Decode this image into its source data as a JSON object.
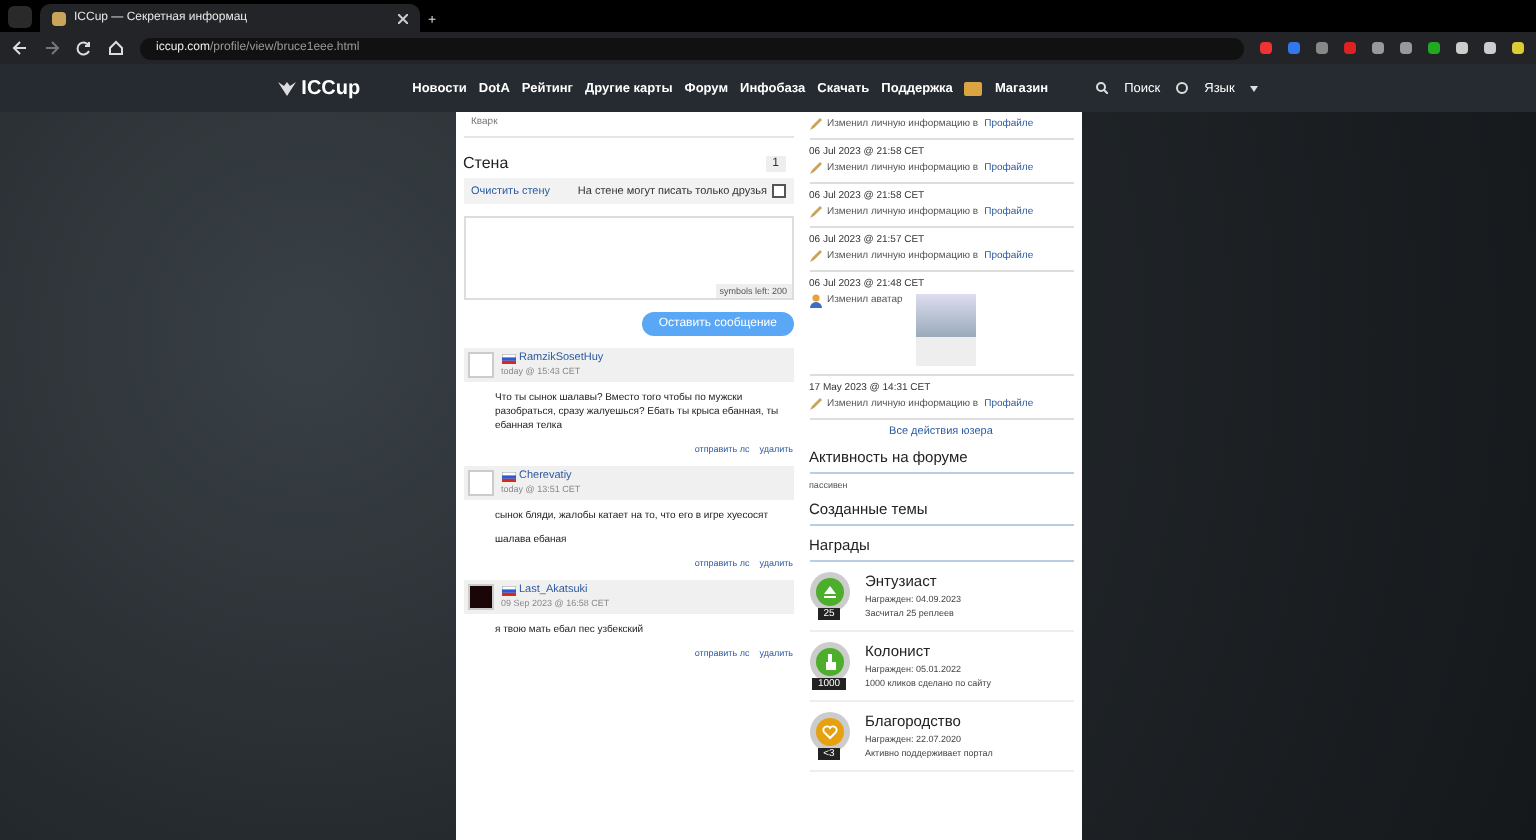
{
  "browser": {
    "tab_title": "ICCup — Секретная информац",
    "new_tab": "+",
    "url_host": "iccup.com",
    "url_path": "/profile/view/bruce1eee.html"
  },
  "site": {
    "logo": "ICCup",
    "nav": [
      "Новости",
      "DotA",
      "Рейтинг",
      "Другие карты",
      "Форум",
      "Инфобаза",
      "Скачать",
      "Поддержка"
    ],
    "shop": "Магазин",
    "search": "Поиск",
    "language": "Язык"
  },
  "profile_note": "Кварк",
  "wall": {
    "title": "Стена",
    "page": "1",
    "clear_link": "Очистить стену",
    "friends_only_label": "На стене могут писать только друзья",
    "friends_only_checked": false,
    "counter": "symbols left: 200",
    "submit": "Оставить сообщение"
  },
  "comments": [
    {
      "author": "RamzikSosetHuy",
      "time": "today @ 15:43 CET",
      "kind": "blank_avatar",
      "paragraphs": [
        "Что ты сынок шалавы? Вместо того чтобы по мужски разобраться, сразу жалуешься? Ебать ты крыса ебанная, ты ебанная телка"
      ],
      "actions": [
        "отправить лс",
        "удалить"
      ]
    },
    {
      "author": "Cherevatiy",
      "time": "today @ 13:51 CET",
      "kind": "blank_avatar",
      "paragraphs": [
        "сынок бляди, жалобы катает на то, что его в игре хуесосят",
        "шалава ебаная"
      ],
      "actions": [
        "отправить лс",
        "удалить"
      ]
    },
    {
      "author": "Last_Akatsuki",
      "time": "09 Sep 2023 @ 16:58 CET",
      "kind": "dark_avatar",
      "paragraphs": [
        "я твою мать ебал пес узбекский"
      ],
      "actions": [
        "отправить лс",
        "удалить"
      ]
    }
  ],
  "activity": [
    {
      "kind": "info",
      "text": "Изменил личную информацию в",
      "link": "Профайле"
    },
    {
      "kind": "info",
      "time": "06 Jul 2023 @ 21:58 CET",
      "text": "Изменил личную информацию в",
      "link": "Профайле"
    },
    {
      "kind": "info",
      "time": "06 Jul 2023 @ 21:58 CET",
      "text": "Изменил личную информацию в",
      "link": "Профайле"
    },
    {
      "kind": "info",
      "time": "06 Jul 2023 @ 21:57 CET",
      "text": "Изменил личную информацию в",
      "link": "Профайле"
    },
    {
      "kind": "avatar",
      "time": "06 Jul 2023 @ 21:48 CET",
      "text": "Изменил аватар"
    },
    {
      "kind": "info",
      "time": "17 May 2023 @ 14:31 CET",
      "text": "Изменил личную информацию в",
      "link": "Профайле"
    }
  ],
  "all_actions": "Все действия юзера",
  "forum_activity": {
    "title": "Активность на форуме",
    "text": "пассивен"
  },
  "created_topics": {
    "title": "Созданные темы"
  },
  "awards": {
    "title": "Награды",
    "items": [
      {
        "name": "Энтузиаст",
        "awarded": "Награжден: 04.09.2023",
        "description": "Засчитал 25 реплеев",
        "count": "25",
        "color": "#4cae2a",
        "kind": "eject"
      },
      {
        "name": "Колонист",
        "awarded": "Награжден: 05.01.2022",
        "description": "1000 кликов сделано по сайту",
        "count": "1000",
        "color": "#4cae2a",
        "kind": "hand"
      },
      {
        "name": "Благородство",
        "awarded": "Награжден: 22.07.2020",
        "description": "Активно поддерживает портал",
        "count": "<3",
        "color": "#e5a10f",
        "kind": "heart"
      }
    ]
  }
}
